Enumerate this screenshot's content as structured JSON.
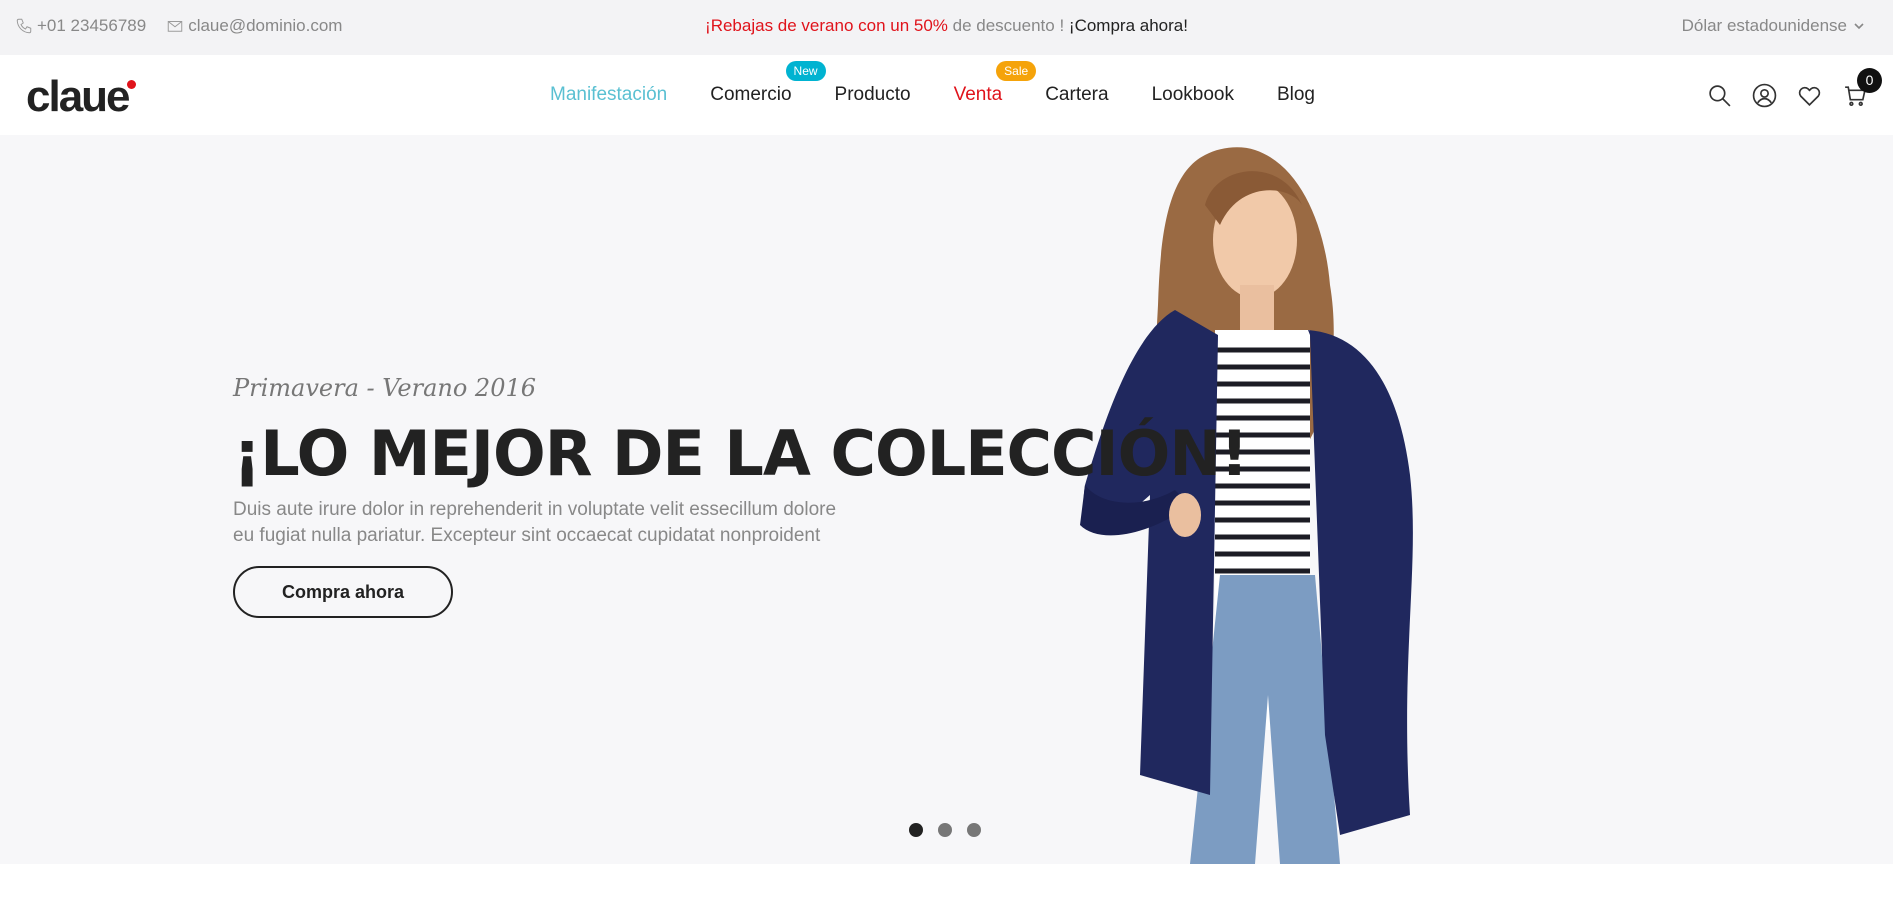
{
  "topbar": {
    "phone": "+01 23456789",
    "email": "claue@dominio.com",
    "promo_part1": "¡Rebajas de verano con un 50%",
    "promo_part2": " de descuento ! ",
    "promo_link": "¡Compra ahora!",
    "currency": "Dólar estadounidense"
  },
  "header": {
    "logo_text": "claue",
    "nav": [
      {
        "label": "Manifestación"
      },
      {
        "label": "Comercio",
        "badge": "New"
      },
      {
        "label": "Producto"
      },
      {
        "label": "Venta",
        "badge": "Sale"
      },
      {
        "label": "Cartera"
      },
      {
        "label": "Lookbook"
      },
      {
        "label": "Blog"
      }
    ],
    "cart_count": "0"
  },
  "hero": {
    "subtitle": "Primavera - Verano 2016",
    "title": "¡LO MEJOR DE LA COLECCIÓN!",
    "description_line1": "Duis aute irure dolor in reprehenderit in voluptate velit essecillum dolore",
    "description_line2": "eu fugiat nulla pariatur. Excepteur sint occaecat cupidatat nonproident",
    "cta": "Compra ahora",
    "slides": 3,
    "active_slide": 1
  },
  "colors": {
    "accent": "#5ac0d2",
    "sale_red": "#e0131b",
    "new_badge": "#00b3d1",
    "sale_badge": "#f5a30a",
    "topbar_bg": "#f3f3f5",
    "hero_bg": "#f7f7f9"
  },
  "icons": [
    "phone-icon",
    "mail-icon",
    "chevron-down-icon",
    "search-icon",
    "user-icon",
    "heart-icon",
    "cart-icon"
  ]
}
